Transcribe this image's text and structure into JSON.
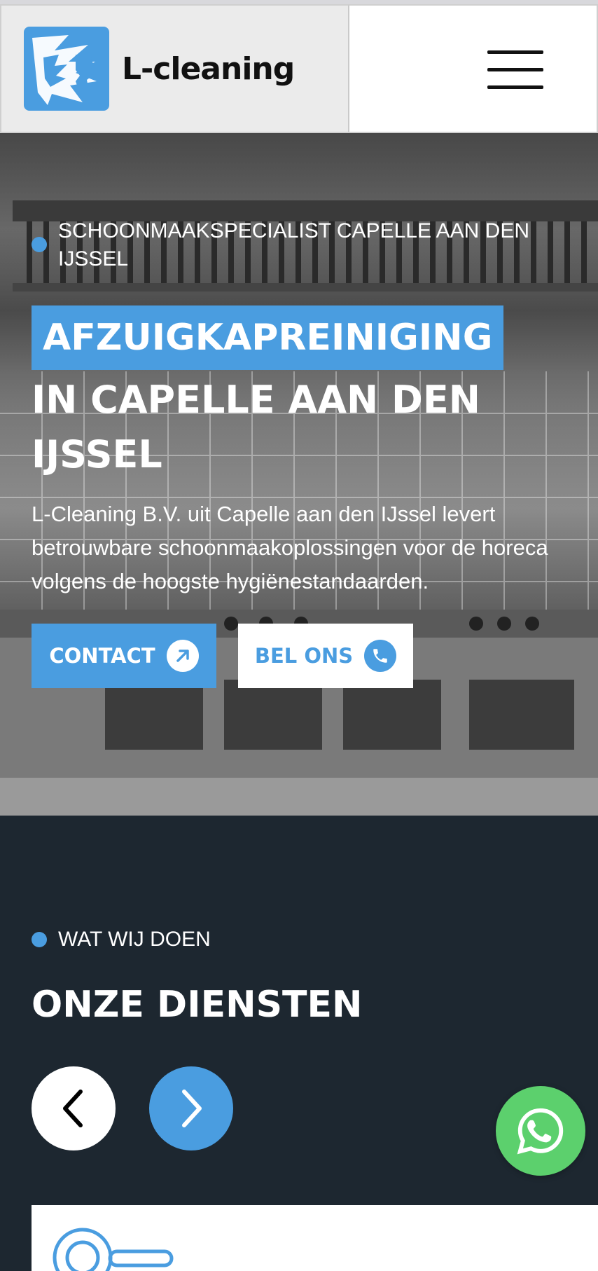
{
  "header": {
    "brand_name": "L-cleaning",
    "logo_icon": "lion-head-logo-icon",
    "menu_icon": "hamburger-menu-icon"
  },
  "hero": {
    "eyebrow": "SCHOONMAAKSPECIALIST CAPELLE AAN DEN IJSSEL",
    "title_highlight": "AFZUIGKAPREINIGING",
    "title_rest": "IN CAPELLE AAN DEN IJSSEL",
    "description": "L-Cleaning B.V. uit Capelle aan den IJssel levert betrouwbare schoonmaakoplossingen voor de horeca volgens de hoogste hygiënestandaarden.",
    "buttons": {
      "contact_label": "CONTACT",
      "contact_icon": "arrow-up-right-icon",
      "call_label": "BEL ONS",
      "call_icon": "phone-icon"
    },
    "background": "commercial-kitchen-photo"
  },
  "services": {
    "eyebrow": "WAT WIJ DOEN",
    "title": "ONZE DIENSTEN",
    "prev_icon": "chevron-left-icon",
    "next_icon": "chevron-right-icon",
    "card_icon": "frying-pan-icon"
  },
  "floating": {
    "whatsapp_icon": "whatsapp-icon"
  },
  "colors": {
    "accent": "#4a9de0",
    "dark_section": "#1d2730",
    "whatsapp": "#5cd06d",
    "header_bg": "#ebebeb"
  }
}
